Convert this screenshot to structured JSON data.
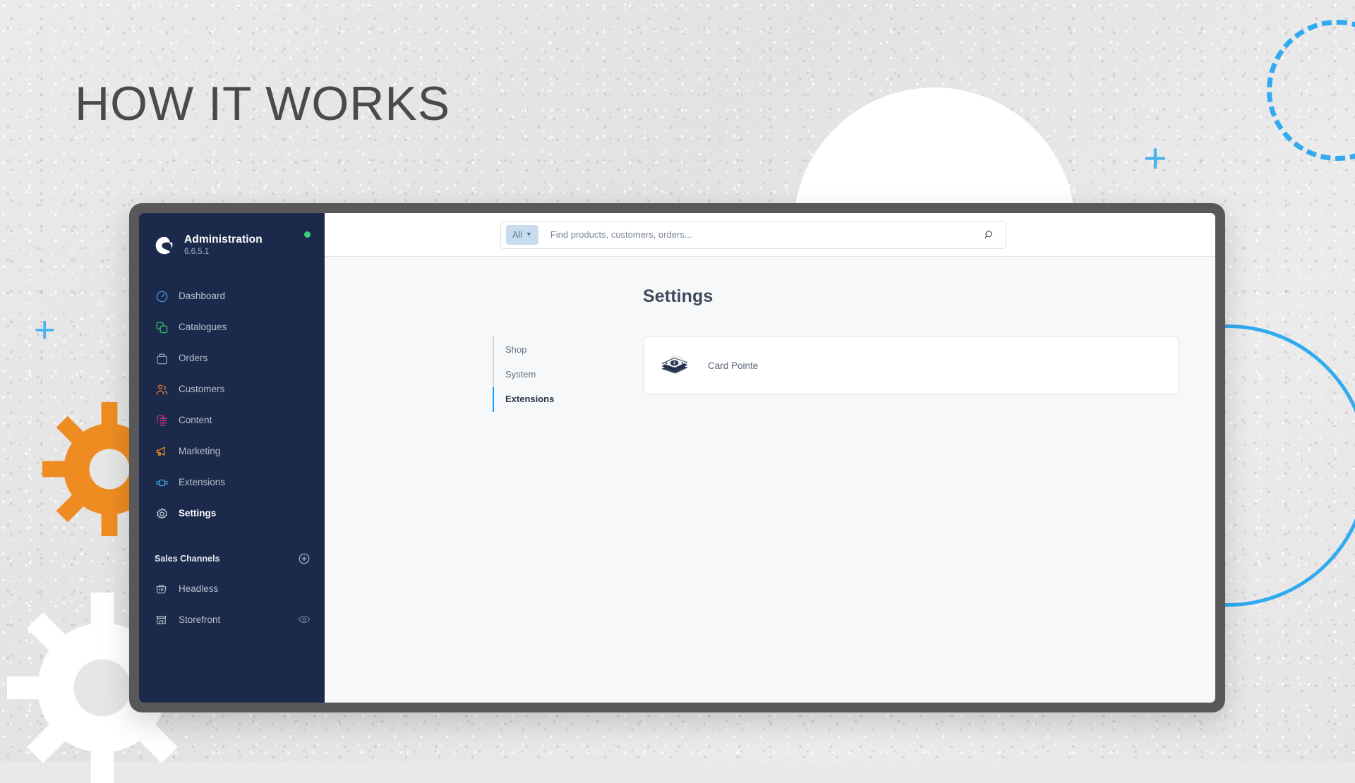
{
  "headline": "HOW IT WORKS",
  "colors": {
    "sidebar_bg": "#1b2a4b",
    "frame": "#58585a",
    "accent_blue": "#189eff",
    "deco_blue": "#31aaef",
    "gear_orange": "#ee8c22",
    "status_green": "#37d07a",
    "content_bg": "#f7f8fa"
  },
  "sidebar": {
    "brand": {
      "logo_icon": "shopware-logo-icon",
      "title": "Administration",
      "version": "6.6.5.1",
      "status_dot": "status-dot-online"
    },
    "nav_items": [
      {
        "label": "Dashboard",
        "icon": "dashboard-gauge-icon",
        "color": "#4a9ae0",
        "active": false
      },
      {
        "label": "Catalogues",
        "icon": "catalogues-copy-icon",
        "color": "#3ec06a",
        "active": false
      },
      {
        "label": "Orders",
        "icon": "orders-bag-icon",
        "color": "#96a0ae",
        "active": false
      },
      {
        "label": "Customers",
        "icon": "customers-people-icon",
        "color": "#ec7b3c",
        "active": false
      },
      {
        "label": "Content",
        "icon": "content-document-icon",
        "color": "#e8368f",
        "active": false
      },
      {
        "label": "Marketing",
        "icon": "marketing-megaphone-icon",
        "color": "#f0971f",
        "active": false
      },
      {
        "label": "Extensions",
        "icon": "extensions-plug-icon",
        "color": "#3ba7ef",
        "active": false
      },
      {
        "label": "Settings",
        "icon": "settings-gear-icon",
        "color": "#c7ced8",
        "active": true
      }
    ],
    "sales_channels": {
      "heading": "Sales Channels",
      "add_icon": "add-circle-icon",
      "items": [
        {
          "label": "Headless",
          "icon": "headless-basket-icon",
          "trailing_icon": ""
        },
        {
          "label": "Storefront",
          "icon": "storefront-shop-icon",
          "trailing_icon": "eye-icon"
        }
      ]
    }
  },
  "topbar": {
    "scope_label": "All",
    "scope_caret_icon": "chevron-down-icon",
    "search_placeholder": "Find products, customers, orders...",
    "search_value": "",
    "search_icon": "search-icon"
  },
  "content": {
    "page_title": "Settings",
    "sub_nav": [
      {
        "label": "Shop",
        "active": false
      },
      {
        "label": "System",
        "active": false
      },
      {
        "label": "Extensions",
        "active": true
      }
    ],
    "cards": [
      {
        "name": "Card Pointe",
        "icon": "cash-stack-icon"
      }
    ]
  }
}
